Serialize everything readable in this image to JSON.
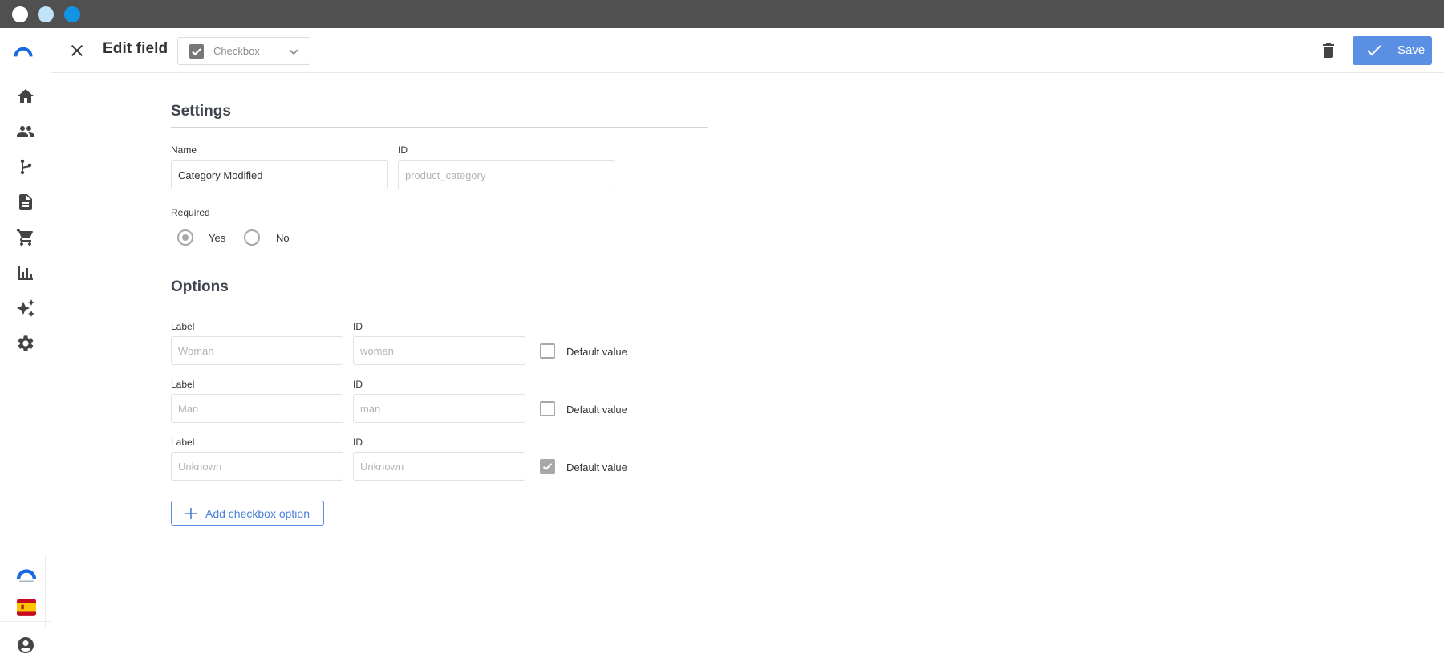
{
  "window": {
    "traffic_lights": [
      {
        "name": "close",
        "color": "#ffffff"
      },
      {
        "name": "minimize",
        "color": "#bfe3f7"
      },
      {
        "name": "maximize",
        "color": "#1194e4"
      }
    ]
  },
  "sidebar": {
    "logo_icon": "brand-arc-logo",
    "items": [
      {
        "name": "home",
        "icon": "home-icon"
      },
      {
        "name": "people",
        "icon": "people-icon"
      },
      {
        "name": "flows",
        "icon": "branch-icon"
      },
      {
        "name": "documents",
        "icon": "document-icon"
      },
      {
        "name": "commerce",
        "icon": "cart-icon"
      },
      {
        "name": "analytics",
        "icon": "bar-chart-icon"
      },
      {
        "name": "ai",
        "icon": "sparkles-icon"
      },
      {
        "name": "settings",
        "icon": "gear-icon"
      }
    ],
    "bottom": {
      "workspace_icon": "workspace-logo-icon",
      "language_flag": "spain-flag-icon",
      "account_icon": "account-circle-icon"
    }
  },
  "header": {
    "title": "Edit field",
    "field_type": "Checkbox",
    "save_label": "Save",
    "accent_color": "#5b8fe3"
  },
  "settings": {
    "title": "Settings",
    "name_label": "Name",
    "name_value": "Category Modified",
    "id_label": "ID",
    "id_placeholder": "product_category",
    "required_label": "Required",
    "required_options": [
      "Yes",
      "No"
    ],
    "required_selected": "Yes"
  },
  "options": {
    "title": "Options",
    "label_caption": "Label",
    "id_caption": "ID",
    "default_caption": "Default value",
    "rows": [
      {
        "label_placeholder": "Woman",
        "id_placeholder": "woman",
        "default": false
      },
      {
        "label_placeholder": "Man",
        "id_placeholder": "man",
        "default": false
      },
      {
        "label_placeholder": "Unknown",
        "id_placeholder": "Unknown",
        "default": true
      }
    ],
    "add_label": "Add checkbox option"
  }
}
